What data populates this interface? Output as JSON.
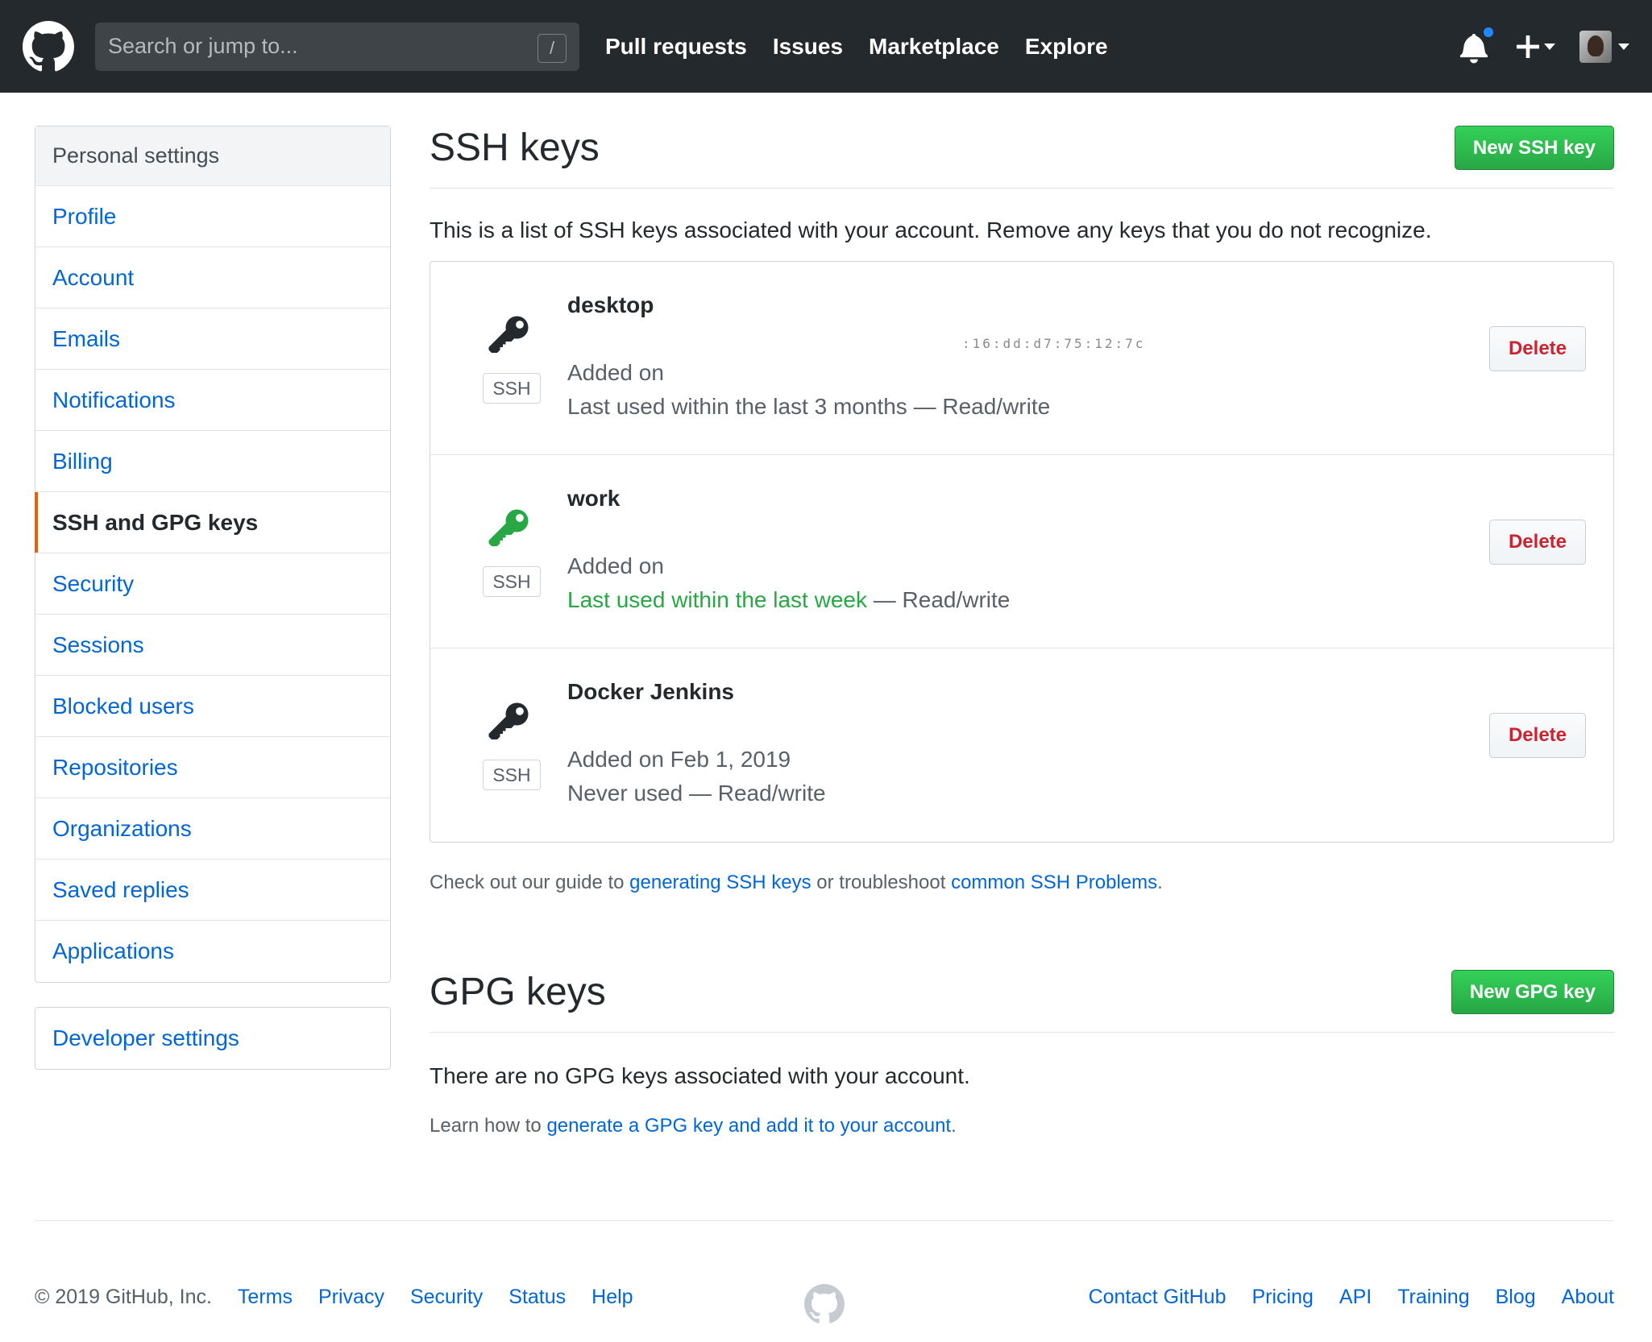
{
  "header": {
    "search_placeholder": "Search or jump to...",
    "search_shortcut": "/",
    "nav": [
      "Pull requests",
      "Issues",
      "Marketplace",
      "Explore"
    ]
  },
  "sidebar": {
    "heading": "Personal settings",
    "items": [
      {
        "label": "Profile"
      },
      {
        "label": "Account"
      },
      {
        "label": "Emails"
      },
      {
        "label": "Notifications"
      },
      {
        "label": "Billing"
      },
      {
        "label": "SSH and GPG keys",
        "selected": true
      },
      {
        "label": "Security"
      },
      {
        "label": "Sessions"
      },
      {
        "label": "Blocked users"
      },
      {
        "label": "Repositories"
      },
      {
        "label": "Organizations"
      },
      {
        "label": "Saved replies"
      },
      {
        "label": "Applications"
      }
    ],
    "developer_settings": "Developer settings"
  },
  "ssh": {
    "title": "SSH keys",
    "new_button": "New SSH key",
    "description": "This is a list of SSH keys associated with your account. Remove any keys that you do not recognize.",
    "keys": [
      {
        "title": "desktop",
        "type": "SSH",
        "fingerprint": ":16:dd:d7:75:12:7c",
        "added": "Added on",
        "last_used": "Last used within the last 3 months",
        "access": " — Read/write",
        "recent": false,
        "icon_color": "#24292e",
        "delete": "Delete"
      },
      {
        "title": "work",
        "type": "SSH",
        "fingerprint": "",
        "added": "Added on",
        "last_used": "Last used within the last week",
        "access": " — Read/write",
        "recent": true,
        "icon_color": "#28a745",
        "delete": "Delete"
      },
      {
        "title": "Docker Jenkins",
        "type": "SSH",
        "fingerprint": "",
        "added": "Added on Feb 1, 2019",
        "last_used": "Never used",
        "access": " — Read/write",
        "recent": false,
        "icon_color": "#24292e",
        "delete": "Delete"
      }
    ],
    "guide_prefix": "Check out our guide to ",
    "guide_link1": "generating SSH keys",
    "guide_mid": " or troubleshoot ",
    "guide_link2": "common SSH Problems",
    "guide_suffix": "."
  },
  "gpg": {
    "title": "GPG keys",
    "new_button": "New GPG key",
    "empty": "There are no GPG keys associated with your account.",
    "learn_prefix": "Learn how to ",
    "learn_link": "generate a GPG key and add it to your account",
    "learn_suffix": "."
  },
  "footer": {
    "copyright": "© 2019 GitHub, Inc.",
    "left_links": [
      "Terms",
      "Privacy",
      "Security",
      "Status",
      "Help"
    ],
    "right_links": [
      "Contact GitHub",
      "Pricing",
      "API",
      "Training",
      "Blog",
      "About"
    ]
  }
}
